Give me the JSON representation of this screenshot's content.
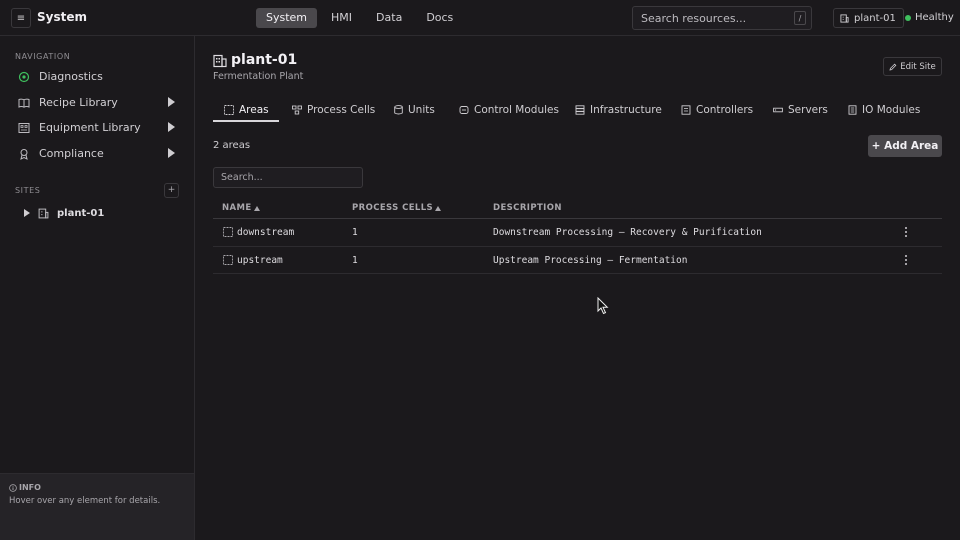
{
  "app": {
    "title": "System",
    "menu_icon": "hamburger-icon"
  },
  "topnav": {
    "items": [
      {
        "label": "System",
        "active": true
      },
      {
        "label": "HMI",
        "active": false
      },
      {
        "label": "Data",
        "active": false
      },
      {
        "label": "Docs",
        "active": false
      }
    ]
  },
  "search": {
    "placeholder": "Search resources...",
    "shortcut": "/"
  },
  "site_selector": {
    "label": "plant-01",
    "icon": "building-icon"
  },
  "status": {
    "label": "Healthy",
    "color": "#3fbf5e"
  },
  "sidebar": {
    "nav_heading": "NAVIGATION",
    "items": [
      {
        "label": "Diagnostics",
        "icon": "diagnostics-icon",
        "expandable": false
      },
      {
        "label": "Recipe Library",
        "icon": "book-icon",
        "expandable": true
      },
      {
        "label": "Equipment Library",
        "icon": "equipment-icon",
        "expandable": true
      },
      {
        "label": "Compliance",
        "icon": "award-icon",
        "expandable": true
      }
    ],
    "sites_heading": "SITES",
    "sites_add": "+",
    "sites": [
      {
        "label": "plant-01"
      }
    ]
  },
  "info": {
    "title": "INFO",
    "text": "Hover over any element for details."
  },
  "page": {
    "title": "plant-01",
    "subtitle": "Fermentation Plant",
    "edit_label": "Edit Site",
    "tabs": [
      {
        "label": "Areas",
        "icon": "areas-icon",
        "active": true
      },
      {
        "label": "Process Cells",
        "icon": "process-cells-icon",
        "active": false
      },
      {
        "label": "Units",
        "icon": "units-icon",
        "active": false
      },
      {
        "label": "Control Modules",
        "icon": "control-module-icon",
        "active": false
      },
      {
        "label": "Infrastructure",
        "icon": "infrastructure-icon",
        "active": false
      },
      {
        "label": "Controllers",
        "icon": "controller-icon",
        "active": false
      },
      {
        "label": "Servers",
        "icon": "server-icon",
        "active": false
      },
      {
        "label": "IO Modules",
        "icon": "io-module-icon",
        "active": false
      }
    ],
    "count_label": "2 areas",
    "add_label": "+ Add Area",
    "search_placeholder": "Search...",
    "table": {
      "columns": [
        "NAME",
        "PROCESS CELLS",
        "DESCRIPTION"
      ],
      "rows": [
        {
          "name": "downstream",
          "process_cells": "1",
          "description": "Downstream Processing — Recovery & Purification"
        },
        {
          "name": "upstream",
          "process_cells": "1",
          "description": "Upstream Processing — Fermentation"
        }
      ]
    }
  }
}
